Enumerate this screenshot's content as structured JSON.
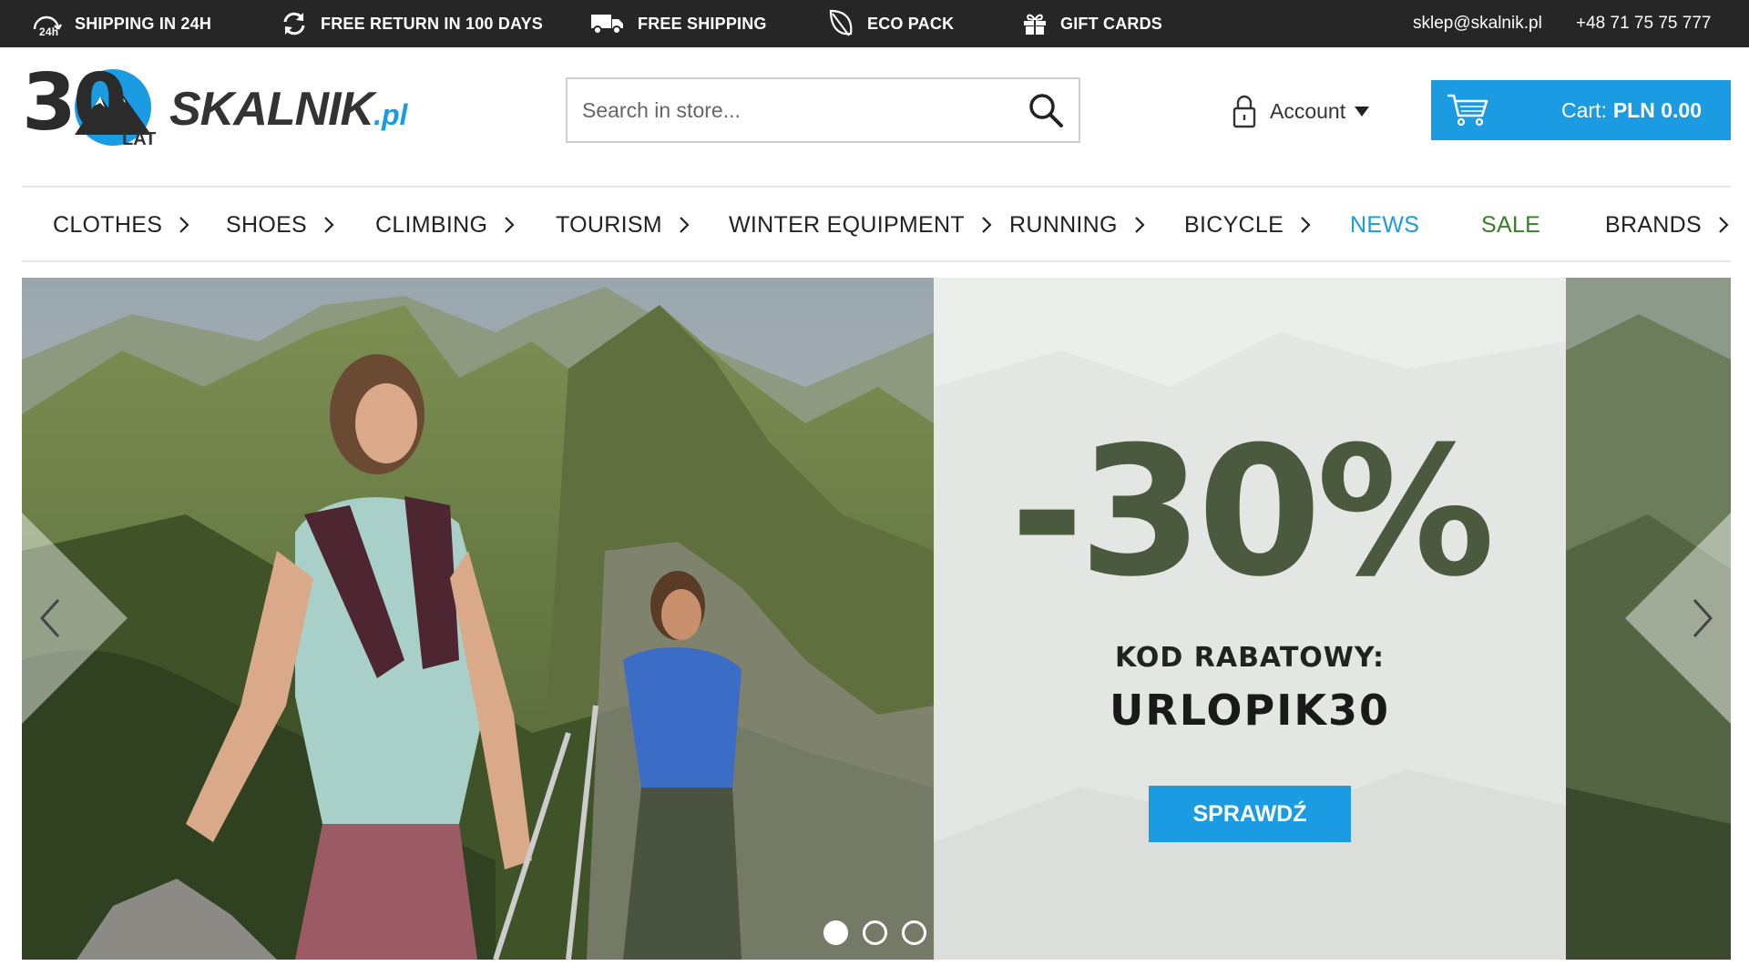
{
  "topbar": {
    "items": [
      {
        "label": "SHIPPING IN 24H",
        "icon": "shipping-24h-icon"
      },
      {
        "label": "FREE RETURN IN 100 DAYS",
        "icon": "return-arrows-icon"
      },
      {
        "label": "FREE SHIPPING",
        "icon": "truck-icon"
      },
      {
        "label": "ECO PACK",
        "icon": "leaf-icon"
      },
      {
        "label": "GIFT CARDS",
        "icon": "gift-icon"
      }
    ],
    "email": "sklep@skalnik.pl",
    "phone": "+48 71 75 75 777"
  },
  "header": {
    "logo": {
      "number": "30",
      "lat": "LAT",
      "brand": "SKALNIK",
      "domain": ".pl"
    },
    "search": {
      "placeholder": "Search in store..."
    },
    "account_label": "Account",
    "cart": {
      "label": "Cart:",
      "amount": "PLN 0.00"
    }
  },
  "nav": {
    "items": [
      {
        "label": "CLOTHES",
        "has_submenu": true
      },
      {
        "label": "SHOES",
        "has_submenu": true
      },
      {
        "label": "CLIMBING",
        "has_submenu": true
      },
      {
        "label": "TOURISM",
        "has_submenu": true
      },
      {
        "label": "WINTER EQUIPMENT",
        "has_submenu": true
      },
      {
        "label": "RUNNING",
        "has_submenu": true
      },
      {
        "label": "BICYCLE",
        "has_submenu": true
      },
      {
        "label": "NEWS",
        "has_submenu": false
      },
      {
        "label": "SALE",
        "has_submenu": false
      },
      {
        "label": "BRANDS",
        "has_submenu": true
      }
    ]
  },
  "hero": {
    "discount": "-30%",
    "code_label": "KOD RABATOWY:",
    "code": "URLOPIK30",
    "cta": "SPRAWDŹ",
    "slides": {
      "count": 3,
      "active": 1
    }
  },
  "colors": {
    "accent": "#1a9be2",
    "topbar_bg": "#262626",
    "sale": "#3a7d2c",
    "text": "#222222"
  }
}
